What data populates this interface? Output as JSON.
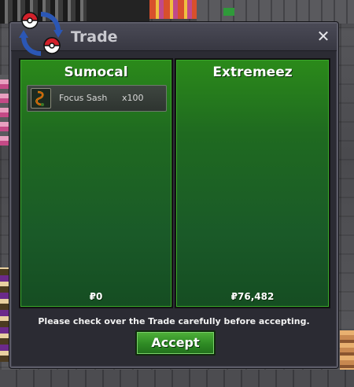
{
  "dialog": {
    "title": "Trade",
    "close_label": "✕",
    "notice": "Please check over the Trade carefully before accepting.",
    "accept_label": "Accept"
  },
  "left_panel": {
    "player": "Sumocal",
    "items": [
      {
        "name": "Focus Sash",
        "quantity": "x100",
        "icon": "focus-sash-icon"
      }
    ],
    "money": "₽0"
  },
  "right_panel": {
    "player": "Extremeez",
    "items": [],
    "money": "₽76,482"
  },
  "colors": {
    "panel_green": "#1f6a20",
    "accept_green": "#2e8a24",
    "window": "#2b2b33"
  }
}
